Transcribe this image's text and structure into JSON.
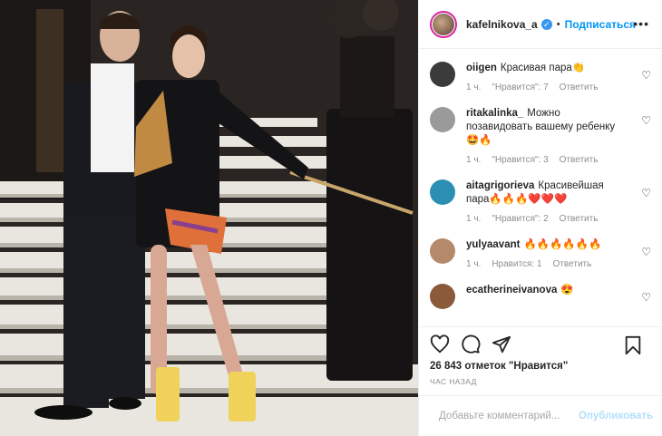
{
  "header": {
    "username": "kafelnikova_a",
    "verified_mark": "✓",
    "separator": "•",
    "follow_label": "Подписаться",
    "more_label": "•••"
  },
  "comments": [
    {
      "username": "oiigen",
      "text": "Красивая пара👏",
      "time": "1 ч.",
      "likes": "\"Нравится\": 7",
      "reply": "Ответить",
      "avatar_color": "#3b3b3b"
    },
    {
      "username": "ritakalinka_",
      "text": "Можно позавидовать вашему ребенку 🤩🔥",
      "time": "1 ч.",
      "likes": "\"Нравится\": 3",
      "reply": "Ответить",
      "avatar_color": "#9a9a9a"
    },
    {
      "username": "aitagrigorieva",
      "text": "Красивейшая пара🔥🔥🔥❤️❤️❤️",
      "time": "1 ч.",
      "likes": "\"Нравится\": 2",
      "reply": "Ответить",
      "avatar_color": "#2a8fb0"
    },
    {
      "username": "yulyaavant",
      "text": "🔥🔥🔥🔥🔥🔥",
      "time": "1 ч.",
      "likes": "Нравится: 1",
      "reply": "Ответить",
      "avatar_color": "#b58a6a"
    },
    {
      "username": "ecatherineivanova",
      "text": "😍",
      "time": "",
      "likes": "",
      "reply": "",
      "avatar_color": "#8a5a3a"
    }
  ],
  "likes_text": "26 843 отметок \"Нравится\"",
  "time_ago": "ЧАС НАЗАД",
  "add_comment": {
    "placeholder": "Добавьте комментарий...",
    "publish_label": "Опубликовать"
  },
  "heart_glyph": "♡",
  "colors": {
    "accent": "#0095f6",
    "muted": "#8e8e8e",
    "publish_disabled": "#b2dffc"
  },
  "icons": [
    "like-icon",
    "comment-icon",
    "share-icon",
    "bookmark-icon",
    "emoji-icon",
    "verified-badge-icon"
  ]
}
